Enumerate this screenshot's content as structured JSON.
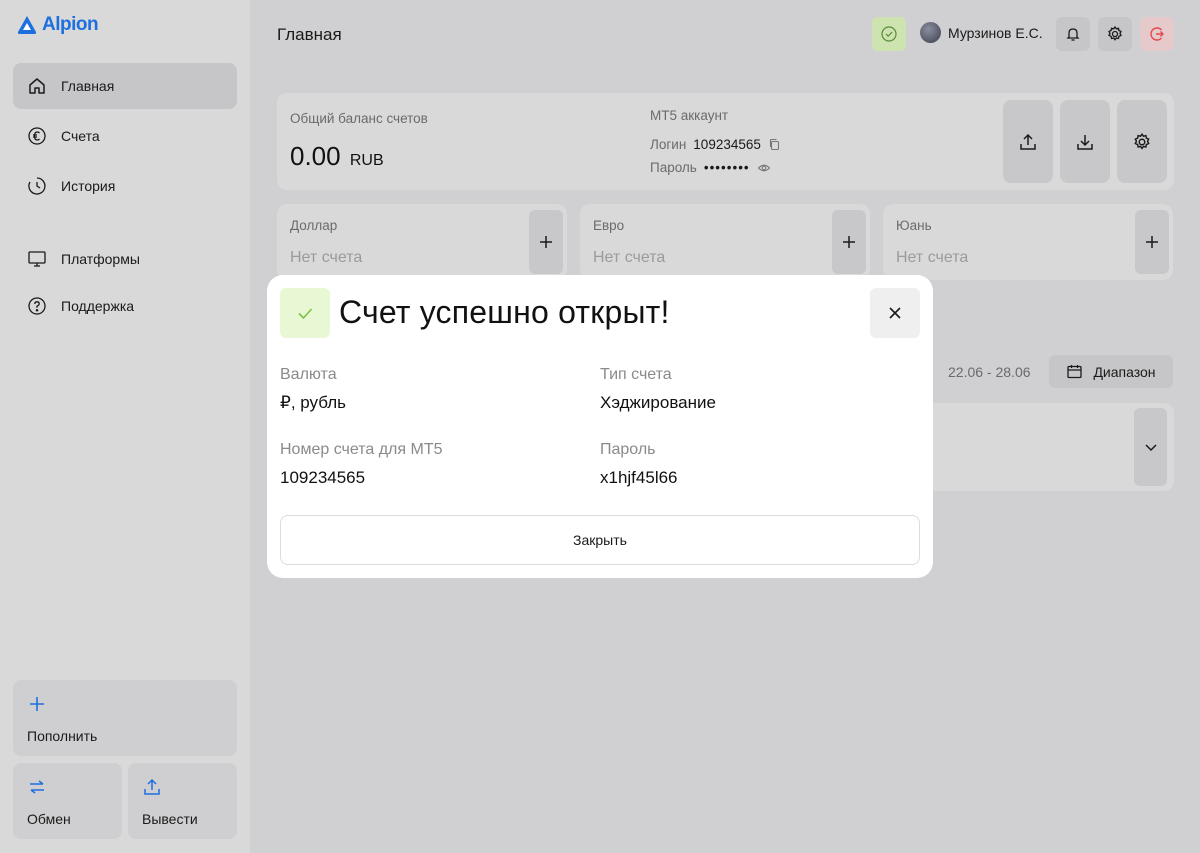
{
  "brand": {
    "name": "Alpion",
    "color": "#1d6fe0"
  },
  "sidebar": {
    "items": [
      {
        "label": "Главная",
        "icon": "home-icon",
        "active": true
      },
      {
        "label": "Счета",
        "icon": "euro-icon",
        "active": false
      },
      {
        "label": "История",
        "icon": "clock-icon",
        "active": false
      },
      {
        "label": "Платформы",
        "icon": "monitor-icon",
        "active": false
      },
      {
        "label": "Поддержка",
        "icon": "help-icon",
        "active": false
      }
    ],
    "actions": {
      "deposit": "Пополнить",
      "exchange": "Обмен",
      "withdraw": "Вывести"
    }
  },
  "header": {
    "title": "Главная",
    "user_name": "Мурзинов Е.С."
  },
  "balance": {
    "label": "Общий баланс счетов",
    "amount": "0.00",
    "currency": "RUB"
  },
  "mt5": {
    "title": "MT5 аккаунт",
    "login_label": "Логин",
    "login": "109234565",
    "password_label": "Пароль",
    "password_mask": "••••••••"
  },
  "currencies": [
    {
      "name": "Доллар",
      "state": "Нет счета"
    },
    {
      "name": "Евро",
      "state": "Нет счета"
    },
    {
      "name": "Юань",
      "state": "Нет счета"
    }
  ],
  "history": {
    "range_text": "22.06 - 28.06",
    "range_button": "Диапазон"
  },
  "modal": {
    "title": "Счет успешно открыт!",
    "currency_label": "Валюта",
    "currency_value": "₽, рубль",
    "type_label": "Тип счета",
    "type_value": "Хэджирование",
    "number_label": "Номер счета для MT5",
    "number_value": "109234565",
    "password_label": "Пароль",
    "password_value": "x1hjf45l66",
    "close_button": "Закрыть"
  },
  "colors": {
    "accent": "#1d6fe0",
    "success_bg": "#e9f8d4",
    "success": "#7cc243",
    "logout": "#e5484d"
  }
}
